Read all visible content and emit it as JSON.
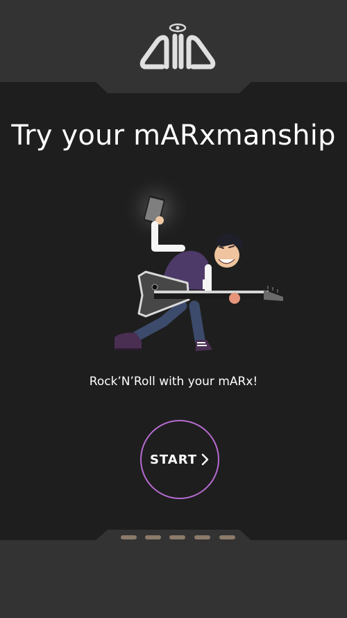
{
  "header": {
    "logo_name": "marx-logo"
  },
  "main": {
    "title": "Try your mARxmanship",
    "illustration_name": "guitarist-illustration",
    "subtitle": "Rock’N’Roll with your mARx!"
  },
  "start_button": {
    "label": "START",
    "icon": "chevron-right-icon",
    "border_color": "#b66bd0"
  },
  "pager": {
    "count": 5,
    "color": "#8c7a6a"
  },
  "colors": {
    "background": "#1e1e1e",
    "panel": "#333333",
    "accent": "#b66bd0"
  }
}
